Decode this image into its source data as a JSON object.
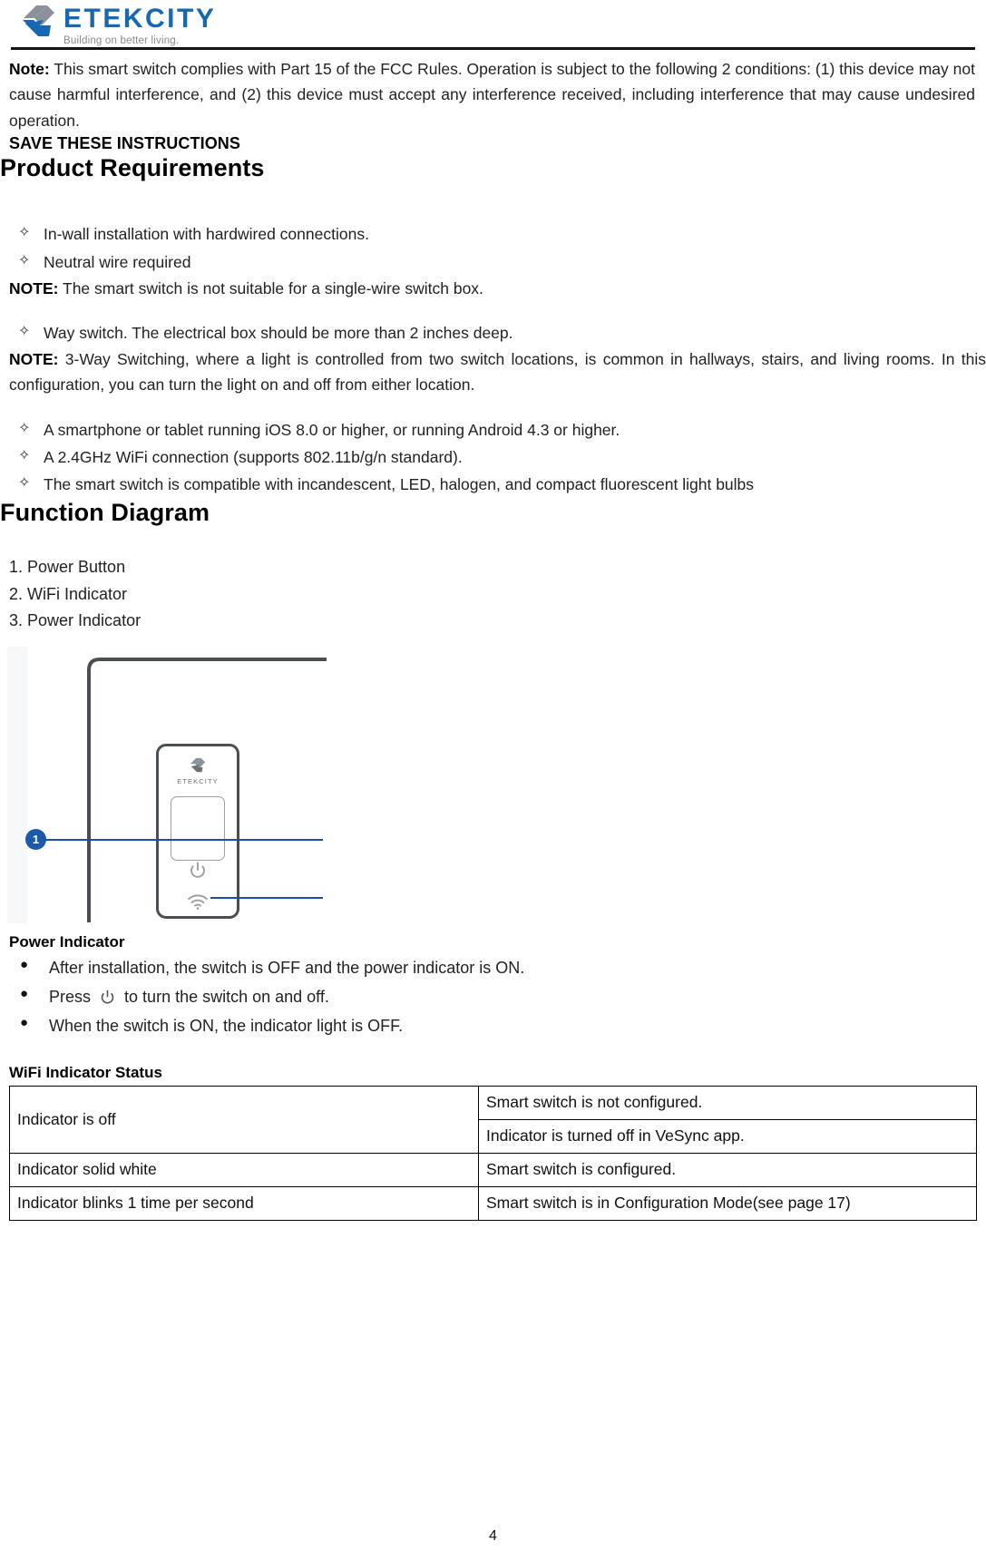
{
  "brand": {
    "name": "ETEKCITY",
    "tagline": "Building on better living.",
    "logo_blue": "#1668b3",
    "logo_gray": "#8a9199"
  },
  "note": {
    "label": "Note:",
    "text": "This smart switch complies with Part 15 of the FCC Rules. Operation is subject to the following 2 conditions: (1) this device may not cause harmful interference, and (2) this device must accept any interference received, including interference that may cause undesired operation."
  },
  "save_instructions": "SAVE THESE INSTRUCTIONS",
  "product_requirements": {
    "heading": "Product Requirements",
    "bullet_glyph": "✧",
    "items": [
      {
        "type": "bullet",
        "text": "In-wall installation with hardwired connections."
      },
      {
        "type": "bullet",
        "text": "Neutral wire required"
      },
      {
        "type": "note",
        "label": "NOTE:",
        "text": "The smart switch is not suitable for a single-wire switch box."
      },
      {
        "type": "bullet",
        "text": "Way switch. The electrical box should be more than 2 inches deep."
      },
      {
        "type": "note",
        "label": "NOTE:",
        "text": "3-Way Switching, where a light is controlled from two switch locations, is common in hallways, stairs, and living rooms. In this configuration, you can turn the light on and off from either location."
      },
      {
        "type": "bullet",
        "text": "A smartphone or tablet running iOS 8.0 or higher, or running Android 4.3 or higher."
      },
      {
        "type": "bullet",
        "text": "A 2.4GHz WiFi connection (supports 802.11b/g/n standard)."
      },
      {
        "type": "bullet",
        "text": "The smart switch is compatible with incandescent, LED, halogen, and compact fluorescent light bulbs"
      }
    ]
  },
  "function_diagram": {
    "heading": "Function Diagram",
    "legend": [
      "1. Power Button",
      "2. WiFi Indicator",
      "3. Power Indicator"
    ],
    "callout_label": "1",
    "device_brand": "ETEKCITY",
    "callout_color": "#1a5aa8",
    "leader_color": "#1f4e9c",
    "icons": {
      "power": "power-icon",
      "wifi": "wifi-icon"
    }
  },
  "power_indicator": {
    "heading": "Power Indicator",
    "bullet_glyph": "●",
    "items": [
      {
        "pre": "After installation, the switch is OFF and the power indicator is   ON.",
        "icon": null,
        "post": ""
      },
      {
        "pre": "Press",
        "icon": "power-icon",
        "post": "to turn the switch on and off."
      },
      {
        "pre": "When the switch is ON, the indicator light is OFF.",
        "icon": null,
        "post": ""
      }
    ]
  },
  "wifi_status": {
    "heading": "WiFi Indicator Status",
    "rows": [
      {
        "condition": "Indicator is off",
        "span": 2,
        "meanings": [
          "Smart switch is not configured.",
          "Indicator is turned off in VeSync app."
        ]
      },
      {
        "condition": "Indicator solid white",
        "span": 1,
        "meanings": [
          "Smart switch is configured."
        ]
      },
      {
        "condition": "Indicator blinks 1 time per second",
        "span": 1,
        "meanings": [
          "Smart switch is in Configuration Mode(see page 17)"
        ]
      }
    ]
  },
  "page_number": "4"
}
